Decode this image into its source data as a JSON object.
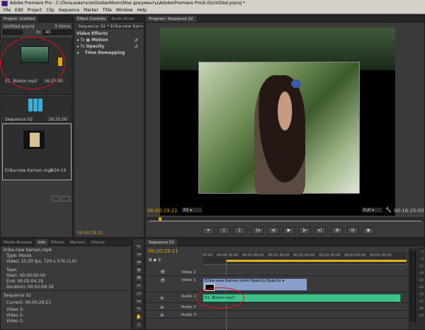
{
  "titlebar": {
    "title": "Adobe Premiere Pro - C:\\Пользователи\\StalkerMoon\\Мои документы\\Adobe\\Premiere Pro\\6.0\\Untitled.prproj *"
  },
  "menu": [
    "File",
    "Edit",
    "Project",
    "Clip",
    "Sequence",
    "Marker",
    "Title",
    "Window",
    "Help"
  ],
  "project": {
    "tab": "Project: Untitled",
    "file": "Untitled.prproj",
    "items_count": "3 Items",
    "in_label": "In:",
    "in_value": "All",
    "search_value": "",
    "items": [
      {
        "name": "01. Bolero.mp3",
        "duration": "16:25:00"
      },
      {
        "name": "Sequence 02",
        "duration": "16:25:00"
      },
      {
        "name": "Erika-new Karnen.mp4",
        "duration": "2:04:19"
      }
    ]
  },
  "effects": {
    "tabs": [
      "Effect Controls",
      "Audio Mixer"
    ],
    "sequence_label": "Sequence 02 * Erika-new Karnen...",
    "section": "Video Effects",
    "rows": [
      "Motion",
      "Opacity",
      "Time Remapping"
    ],
    "timecode": "00:00:29:21"
  },
  "program": {
    "tab": "Program: Sequence 02",
    "timecode": "00:00:29:21",
    "fit": "Fit",
    "quality": "Full",
    "duration": "00:16:25:00",
    "buttons": [
      "▾",
      "{",
      "}",
      "|◂",
      "◂|",
      "▶",
      "|▸",
      "▸|",
      "⊞",
      "⊟",
      "◉"
    ]
  },
  "info": {
    "tabs": [
      "Media Browser",
      "Info",
      "Effects",
      "Markers",
      "History"
    ],
    "clip_name": "Erika-new Karnen.mp4",
    "type": "Type: Movie",
    "video": "Video: 25,00 fps, 720 x 576 (1,0)",
    "tape": "Tape:",
    "start": "Start: 00:00:00:00",
    "end": "End: 00:02:04:18",
    "duration": "Duration: 00:02:04:19",
    "sequence": "Sequence 02",
    "current": "Current: 00:00:29:21",
    "tracks": [
      "Video 3:",
      "Video 2:",
      "Video 1:"
    ]
  },
  "tools": [
    "↖",
    "⇥",
    "⇹",
    "⊕",
    "⌘",
    "✂",
    "⇿",
    "↔",
    "✎",
    "✋",
    "⌕"
  ],
  "timeline": {
    "tab": "Sequence 02",
    "timecode": "00:00:29:21",
    "ruler": [
      "00:00",
      "00:00:30:00",
      "00:01:00:00",
      "00:01:30:00",
      "00:02:00:00",
      "00:02:30:00",
      "00:03:00:00",
      "00:03:30:00"
    ],
    "tracks": [
      {
        "label": "Video 2",
        "clip": ""
      },
      {
        "label": "Video 1",
        "clip": "Erika-new Karnen.mp4  Opacity:Opacity ▾"
      },
      {
        "label": "Audio 1",
        "clip": "01. Bolero.mp3"
      },
      {
        "label": "Audio 2",
        "clip": ""
      },
      {
        "label": "Audio 3",
        "clip": ""
      }
    ],
    "meter_labels": [
      "0",
      "-6",
      "-12",
      "-18",
      "-24",
      "-30",
      "-36",
      "-42",
      "-48",
      "-54"
    ]
  },
  "colors": {
    "accent_orange": "#e8a200",
    "audio_clip": "#3ec28a",
    "video_clip": "#8aa0c8",
    "annotation": "#e01010"
  }
}
